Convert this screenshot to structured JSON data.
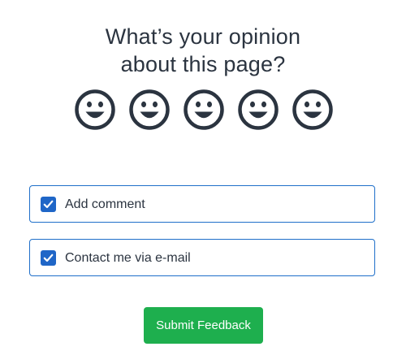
{
  "question": {
    "line1": "What’s your opinion",
    "line2": "about this page?"
  },
  "rating": {
    "faces": [
      "smiley-face-icon",
      "smiley-face-icon",
      "smiley-face-icon",
      "smiley-face-icon",
      "smiley-face-icon"
    ],
    "icon_color": "#2b3440"
  },
  "options": [
    {
      "label": "Add comment",
      "checked": true
    },
    {
      "label": "Contact me via e-mail",
      "checked": true
    }
  ],
  "submit": {
    "label": "Submit Feedback",
    "color": "#1eaf4e"
  },
  "colors": {
    "accent": "#1f66c7",
    "border": "#1f6fc9",
    "text": "#2b3440"
  }
}
